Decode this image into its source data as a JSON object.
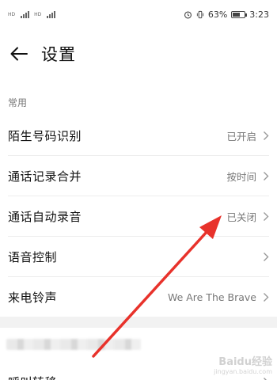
{
  "status_bar": {
    "sim1_label": "HD",
    "sim2_label": "HD",
    "battery_percent": "63%",
    "battery_level": 0.63,
    "time": "3:23"
  },
  "header": {
    "title": "设置"
  },
  "section": {
    "common_label": "常用"
  },
  "settings": [
    {
      "label": "陌生号码识别",
      "value": "已开启"
    },
    {
      "label": "通话记录合并",
      "value": "按时间"
    },
    {
      "label": "通话自动录音",
      "value": "已关闭"
    },
    {
      "label": "语音控制",
      "value": ""
    },
    {
      "label": "来电铃声",
      "value": "We Are The Brave"
    }
  ],
  "partial_row": {
    "label": "呼叫转移"
  },
  "annotation": {
    "arrow_color": "#e8322b"
  },
  "watermark": {
    "main": "Baidu经验",
    "sub": "jingyan.baidu.com"
  }
}
